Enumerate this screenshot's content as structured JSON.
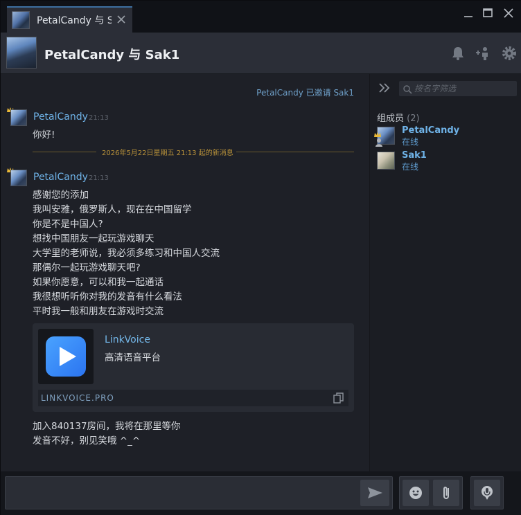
{
  "tab": {
    "title": "PetalCandy 与 S",
    "close_icon": "close-icon"
  },
  "window_controls": {
    "minimize": "minimize-icon",
    "maximize": "maximize-icon",
    "close": "close-icon"
  },
  "header": {
    "title": "PetalCandy 与 Sak1",
    "icons": [
      "bell-icon",
      "add-friend-icon",
      "gear-icon"
    ]
  },
  "system_message": "PetalCandy 已邀请 Sak1",
  "messages": [
    {
      "author": "PetalCandy",
      "time": "21:13",
      "lines": [
        "你好!"
      ]
    },
    {
      "author": "PetalCandy",
      "time": "21:13",
      "lines": [
        "感谢您的添加",
        "我叫安雅，俄罗斯人，现在在中国留学",
        "你是不是中国人?",
        "想找中国朋友一起玩游戏聊天",
        "大学里的老师说，我必须多练习和中国人交流",
        "那偶尔一起玩游戏聊天吧?",
        "如果你愿意，可以和我一起通话",
        "我很想听听你对我的发音有什么看法",
        "平时我一般和朋友在游戏时交流"
      ]
    }
  ],
  "new_messages_divider": "2026年5月22日星期五 21:13 起的新消息",
  "link_card": {
    "title": "LinkVoice",
    "description": "高清语音平台",
    "url": "LINKVOICE.PRO",
    "accent": "#2b74f0"
  },
  "trailing_lines": [
    "加入840137房间，我将在那里等你",
    "发音不好，别见笑哦 ^_^"
  ],
  "sidebar": {
    "filter_placeholder": "按名字筛选",
    "members_label": "组成员",
    "members_count": "(2)",
    "members": [
      {
        "name": "PetalCandy",
        "status": "在线"
      },
      {
        "name": "Sak1",
        "status": "在线"
      }
    ]
  },
  "composer": {
    "value": ""
  },
  "colors": {
    "name_blue": "#6fb3e8",
    "divider_gold": "#b9923a",
    "crown_gold": "#e8b838"
  }
}
